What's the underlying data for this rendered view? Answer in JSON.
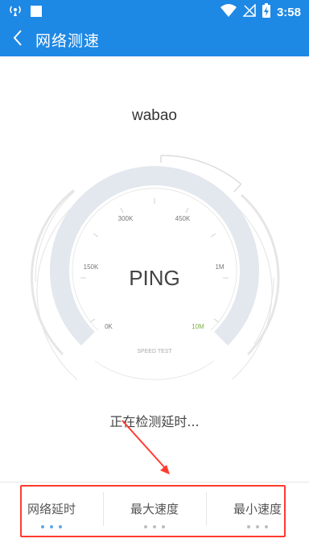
{
  "status_bar": {
    "time": "3:58",
    "icons": [
      "wireless-icon",
      "notification-square-icon",
      "wifi-icon",
      "no-sim-icon",
      "battery-charging-icon"
    ]
  },
  "app_bar": {
    "title": "网络测速",
    "back_icon": "chevron-left-icon"
  },
  "server": {
    "name": "wabao"
  },
  "gauge": {
    "center_text": "PING",
    "sub_label": "SPEED TEST",
    "ticks": [
      "0K",
      "150K",
      "300K",
      "450K",
      "1M",
      "10M"
    ],
    "highlight_tick_color": "#7cb342"
  },
  "status": {
    "text": "正在检测延时..."
  },
  "tabs": [
    {
      "label": "网络延时",
      "active": true
    },
    {
      "label": "最大速度",
      "active": false
    },
    {
      "label": "最小速度",
      "active": false
    }
  ],
  "colors": {
    "primary": "#1e88e5",
    "annotation": "#ff3b30",
    "gauge_band": "#e3e7ee"
  }
}
